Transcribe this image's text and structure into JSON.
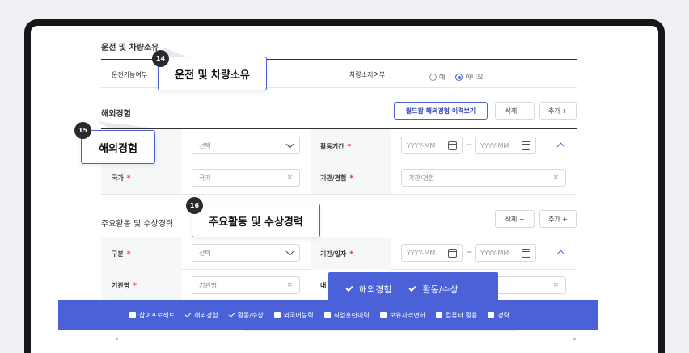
{
  "sections": {
    "driving": {
      "title": "운전 및 차량소유",
      "license_label": "운전가능여부",
      "vehicle_label": "차량소지여부",
      "radio_yes": "예",
      "radio_no": "아니오"
    },
    "overseas": {
      "title": "해외경험",
      "history_button": "월드잡 해외경험 이력보기",
      "delete_button": "삭제 −",
      "add_button": "추가 +",
      "type_select": "선택",
      "period_label": "활동기간",
      "date_from": "YYYY-MM",
      "date_to": "YYYY-MM",
      "tilde": "~",
      "country_label": "국가",
      "country_placeholder": "국가",
      "org_label": "기관/경험",
      "org_placeholder": "기관/경험"
    },
    "activity": {
      "title": "주요활동 및 수상경력",
      "delete_button": "삭제 −",
      "add_button": "추가 +",
      "category_label": "구분",
      "category_select": "선택",
      "period_label": "기간/일자",
      "date_from": "YYYY-MM",
      "date_to": "YYYY-MM",
      "tilde": "~",
      "org_label": "기관명",
      "org_placeholder": "기관명",
      "partial_label": "내"
    }
  },
  "callouts": [
    {
      "number": "14",
      "text": "운전 및 차량소유"
    },
    {
      "number": "15",
      "text": "해외경험"
    },
    {
      "number": "16",
      "text": "주요활동 및 수상경력"
    }
  ],
  "popup": {
    "items": [
      "해외경험",
      "활동/수상"
    ]
  },
  "toolbar": {
    "prev": "‹",
    "next": "›",
    "items": [
      {
        "label": "참여프로젝트",
        "checked": false
      },
      {
        "label": "해외경험",
        "checked": true
      },
      {
        "label": "활동/수상",
        "checked": true
      },
      {
        "label": "외국어능력",
        "checked": false
      },
      {
        "label": "직업훈련이력",
        "checked": false
      },
      {
        "label": "보유자격면허",
        "checked": false
      },
      {
        "label": "컴퓨터 활용",
        "checked": false
      },
      {
        "label": "경력",
        "checked": false
      }
    ]
  },
  "colors": {
    "accent": "#4a61d8",
    "required": "#e0322c",
    "frame": "#17171a"
  }
}
